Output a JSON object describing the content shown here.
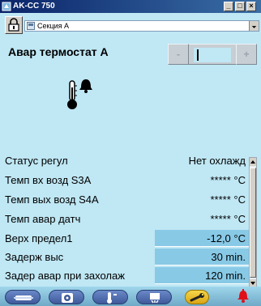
{
  "window": {
    "title": "AK-CC 750",
    "controls": [
      "_",
      "□",
      "×"
    ]
  },
  "header": {
    "section_selector": {
      "value": "Секция А"
    },
    "lock_icon": "lock-icon"
  },
  "page": {
    "title": "Авар термостат А"
  },
  "nav": {
    "prev": "-",
    "next": "+",
    "value": ""
  },
  "params": [
    {
      "label": "Статус регул",
      "value": "Нет охлажд",
      "editable": false
    },
    {
      "label": "Темп вх возд S3A",
      "value": "***** °C",
      "editable": false
    },
    {
      "label": "Темп вых возд S4A",
      "value": "***** °C",
      "editable": false
    },
    {
      "label": "Темп авар датч",
      "value": "***** °C",
      "editable": false
    },
    {
      "label": "Верх предел1",
      "value": "-12,0 °C",
      "editable": true
    },
    {
      "label": "Задерж выс",
      "value": "30 min.",
      "editable": true
    },
    {
      "label": "Задер авар при захолаж",
      "value": "120 min.",
      "editable": true
    }
  ],
  "toolbar": {
    "buttons": [
      "case-icon",
      "fan-icon",
      "thermostat-icon",
      "defrost-icon",
      "wrench-icon"
    ],
    "alarm": "alarm-bell-icon"
  },
  "colors": {
    "background": "#bfe7f4",
    "editable_cell": "#88c9e6",
    "titlebar": "#0a246a",
    "alarm": "#e0101a",
    "wrench_button": "#f6d64a"
  }
}
